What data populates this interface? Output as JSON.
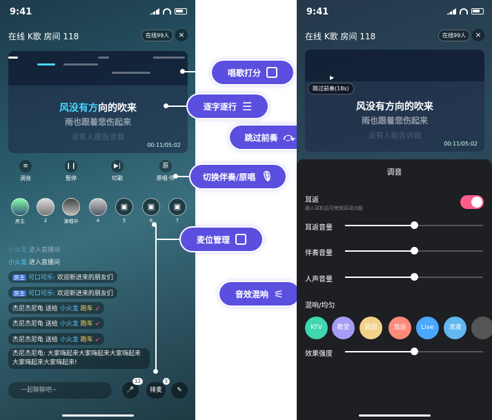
{
  "left_phone": {
    "status_time": "9:41",
    "room_title": "在线 K歌 房间 118",
    "online": "在线99人",
    "close": "×",
    "lyrics": {
      "highlight": "风没有方",
      "rest": "向的吹来",
      "line2": "雨也跟着悲伤起来",
      "line3": "没有人能告诉我",
      "time": "00:11/05:02"
    },
    "controls": [
      {
        "label": "调音",
        "glyph": "≡"
      },
      {
        "label": "暂停",
        "glyph": "❙❙"
      },
      {
        "label": "切歌",
        "glyph": "▶|"
      },
      {
        "label": "原唱·伴",
        "glyph": "原"
      }
    ],
    "seats": [
      {
        "label": "房主",
        "glyph": ""
      },
      {
        "label": "2",
        "glyph": ""
      },
      {
        "label": "演唱中",
        "glyph": ""
      },
      {
        "label": "4",
        "glyph": ""
      },
      {
        "label": "5",
        "glyph": "▣"
      },
      {
        "label": "6",
        "glyph": "▣"
      },
      {
        "label": "7",
        "glyph": "▣"
      }
    ],
    "messages": [
      {
        "user": "小火龙",
        "text": " 进入直播间"
      },
      {
        "user": "小火龙",
        "text": " 进入直播间"
      }
    ],
    "bubbles": [
      {
        "tag": "房主",
        "user": "可口可乐:",
        "text": " 欢迎新进来的朋友们"
      },
      {
        "tag": "房主",
        "user": "可口可乐:",
        "text": " 欢迎新进来的朋友们"
      },
      {
        "pre": "杰尼杰尼龟 送给 ",
        "user": "小火龙",
        "gift": " 跑车"
      },
      {
        "pre": "杰尼杰尼龟 送给 ",
        "user": "小火龙",
        "gift": " 跑车"
      },
      {
        "pre": "杰尼杰尼龟 送给 ",
        "user": "小火龙",
        "gift": " 跑车"
      }
    ],
    "long_msg": "杰尼杰尼龟: 大家嗨起来大家嗨起来大家嗨起来大家嗨起来大家嗨起来!",
    "chat_placeholder": "一起聊聊吧~",
    "mic_badge": "12",
    "queue_label": "排麦",
    "queue_badge": "3"
  },
  "callouts": {
    "score": "唱歌打分",
    "word_by_word": "逐字逐行",
    "skip_intro": "跳过前奏",
    "switch_track": "切换伴奏/原唱",
    "seat_manage": "麦位管理",
    "effects_mix": "音效混响"
  },
  "right_phone": {
    "status_time": "9:41",
    "room_title": "在线 K歌 房间 118",
    "online": "在线99人",
    "close": "×",
    "skip_tip": "跳过前奏(18s)",
    "lyrics": {
      "line1": "风没有方向的吹来",
      "line2": "雨也跟着悲伤起来",
      "line3": "没有人能告诉我",
      "time": "00:11/05:02"
    },
    "panel": {
      "title": "调音",
      "ear_return": "耳返",
      "ear_sub": "插入耳机后可使用耳返功能",
      "ear_volume": "耳返音量",
      "accomp_volume": "伴奏音量",
      "vocal_volume": "人声音量",
      "reverb": "混响/均匀",
      "effect_strength": "效果强度",
      "ear_volume_value": 0.5,
      "accomp_volume_value": 0.5,
      "vocal_volume_value": 0.5,
      "effect_strength_value": 0.5,
      "effects": [
        {
          "label": "KTV",
          "color": "#3fd6b0"
        },
        {
          "label": "教堂",
          "color": "#a79cf5"
        },
        {
          "label": "圆润",
          "color": "#f2d28a"
        },
        {
          "label": "悠远",
          "color": "#ff8a7a"
        },
        {
          "label": "Live",
          "color": "#4aa8ff"
        },
        {
          "label": "清澈",
          "color": "#62b7f0"
        },
        {
          "label": "",
          "color": "#555"
        }
      ]
    }
  }
}
